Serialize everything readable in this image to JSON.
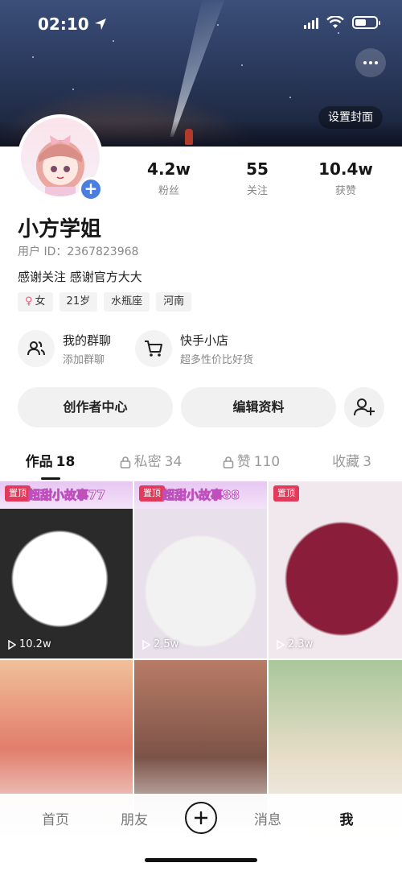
{
  "status": {
    "time": "02:10"
  },
  "cover": {
    "set_cover_label": "设置封面"
  },
  "profile": {
    "name": "小方学姐",
    "user_id": "用户 ID：2367823968",
    "bio": "感谢关注 感谢官方大大",
    "tags": [
      "女",
      "21岁",
      "水瓶座",
      "河南"
    ]
  },
  "stats": [
    {
      "value": "4.2w",
      "label": "粉丝"
    },
    {
      "value": "55",
      "label": "关注"
    },
    {
      "value": "10.4w",
      "label": "获赞"
    }
  ],
  "features": [
    {
      "title": "我的群聊",
      "subtitle": "添加群聊",
      "icon": "group-icon"
    },
    {
      "title": "快手小店",
      "subtitle": "超多性价比好货",
      "icon": "cart-icon"
    }
  ],
  "actions": {
    "creator_center": "创作者中心",
    "edit_profile": "编辑资料"
  },
  "tabs": [
    {
      "label": "作品",
      "count": "18",
      "locked": false
    },
    {
      "label": "私密",
      "count": "34",
      "locked": true
    },
    {
      "label": "赞",
      "count": "110",
      "locked": true
    },
    {
      "label": "收藏",
      "count": "3",
      "locked": false
    }
  ],
  "videos": [
    {
      "pinned_label": "置顶",
      "title": "超甜小故事77",
      "plays": "10.2w"
    },
    {
      "pinned_label": "置顶",
      "title": "超甜小故事88",
      "plays": "2.5w"
    },
    {
      "pinned_label": "置顶",
      "title": "",
      "plays": "2.3w"
    },
    {
      "pinned_label": "",
      "title": "",
      "plays": ""
    },
    {
      "pinned_label": "",
      "title": "",
      "plays": ""
    },
    {
      "pinned_label": "",
      "title": "",
      "plays": ""
    }
  ],
  "nav": {
    "home": "首页",
    "friends": "朋友",
    "messages": "消息",
    "me": "我"
  }
}
